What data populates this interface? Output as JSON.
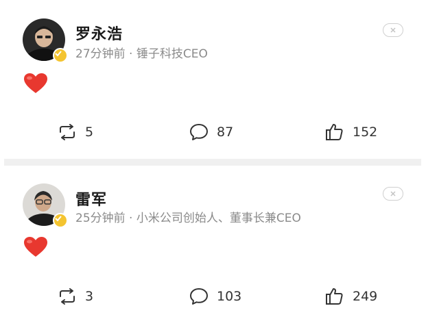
{
  "posts": [
    {
      "author": "罗永浩",
      "meta": "27分钟前 · 锤子科技CEO",
      "reaction": "heart",
      "actions": {
        "reposts": "5",
        "comments": "87",
        "likes": "152"
      }
    },
    {
      "author": "雷军",
      "meta": "25分钟前 · 小米公司创始人、董事长兼CEO",
      "reaction": "heart",
      "actions": {
        "reposts": "3",
        "comments": "103",
        "likes": "249"
      }
    }
  ],
  "icons": {
    "close": "close-icon",
    "repost": "repost-icon",
    "comment": "comment-icon",
    "like": "thumbs-up-icon",
    "verified": "verified-badge-icon",
    "reaction": "heart-emoji"
  },
  "colors": {
    "heart": "#e8382f",
    "verified_badge": "#f4c430",
    "meta_text": "#8a8a8a",
    "divider": "#f0f0f0"
  }
}
